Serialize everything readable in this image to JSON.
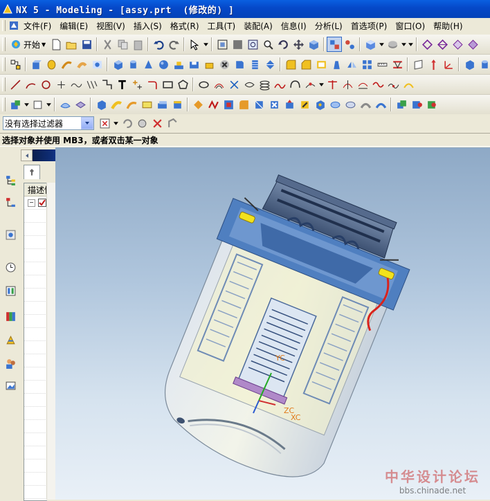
{
  "window": {
    "title": "NX 5 - Modeling - [assy.prt  (修改的) ]"
  },
  "menu": {
    "items": [
      "文件(F)",
      "编辑(E)",
      "视图(V)",
      "插入(S)",
      "格式(R)",
      "工具(T)",
      "装配(A)",
      "信息(I)",
      "分析(L)",
      "首选项(P)",
      "窗口(O)",
      "帮助(H)"
    ]
  },
  "toolbar": {
    "start_label": "开始"
  },
  "filter": {
    "value": "没有选择过滤器"
  },
  "status": {
    "prompt": "选择对象并使用 MB3，或者双击某一对象"
  },
  "navigator": {
    "column_header": "描述性"
  },
  "viewport": {
    "triad_labels": [
      "YC",
      "ZC",
      "XC"
    ]
  },
  "watermark": {
    "text": "中华设计论坛",
    "url": "bbs.chinade.net"
  },
  "colors": {
    "title_bar": "#0548c8",
    "viewport_top": "#8ea9c6",
    "viewport_bottom": "#e9f0f7",
    "part_blue": "#4f7fc0",
    "accent_yellow": "#f2e21c",
    "wire_red": "#d9231d"
  }
}
